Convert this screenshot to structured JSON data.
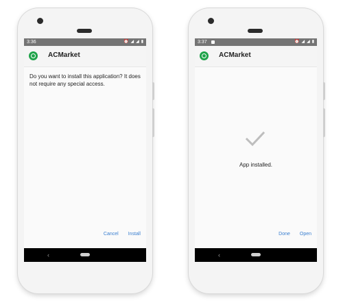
{
  "left_phone": {
    "status_time": "3:36",
    "app_title": "ACMarket",
    "message": "Do you want to install this application? It does not require any special access.",
    "cancel_label": "Cancel",
    "install_label": "Install"
  },
  "right_phone": {
    "status_time": "3:37",
    "app_title": "ACMarket",
    "installed_text": "App installed.",
    "done_label": "Done",
    "open_label": "Open"
  },
  "colors": {
    "accent": "#3a7fd0",
    "logo": "#1fa34a",
    "status_bar": "#747474"
  },
  "icons": {
    "status": [
      "alarm-icon",
      "wifi-icon",
      "signal-icon",
      "battery-icon"
    ],
    "check": "check-icon",
    "back": "back-icon",
    "home": "home-icon"
  }
}
